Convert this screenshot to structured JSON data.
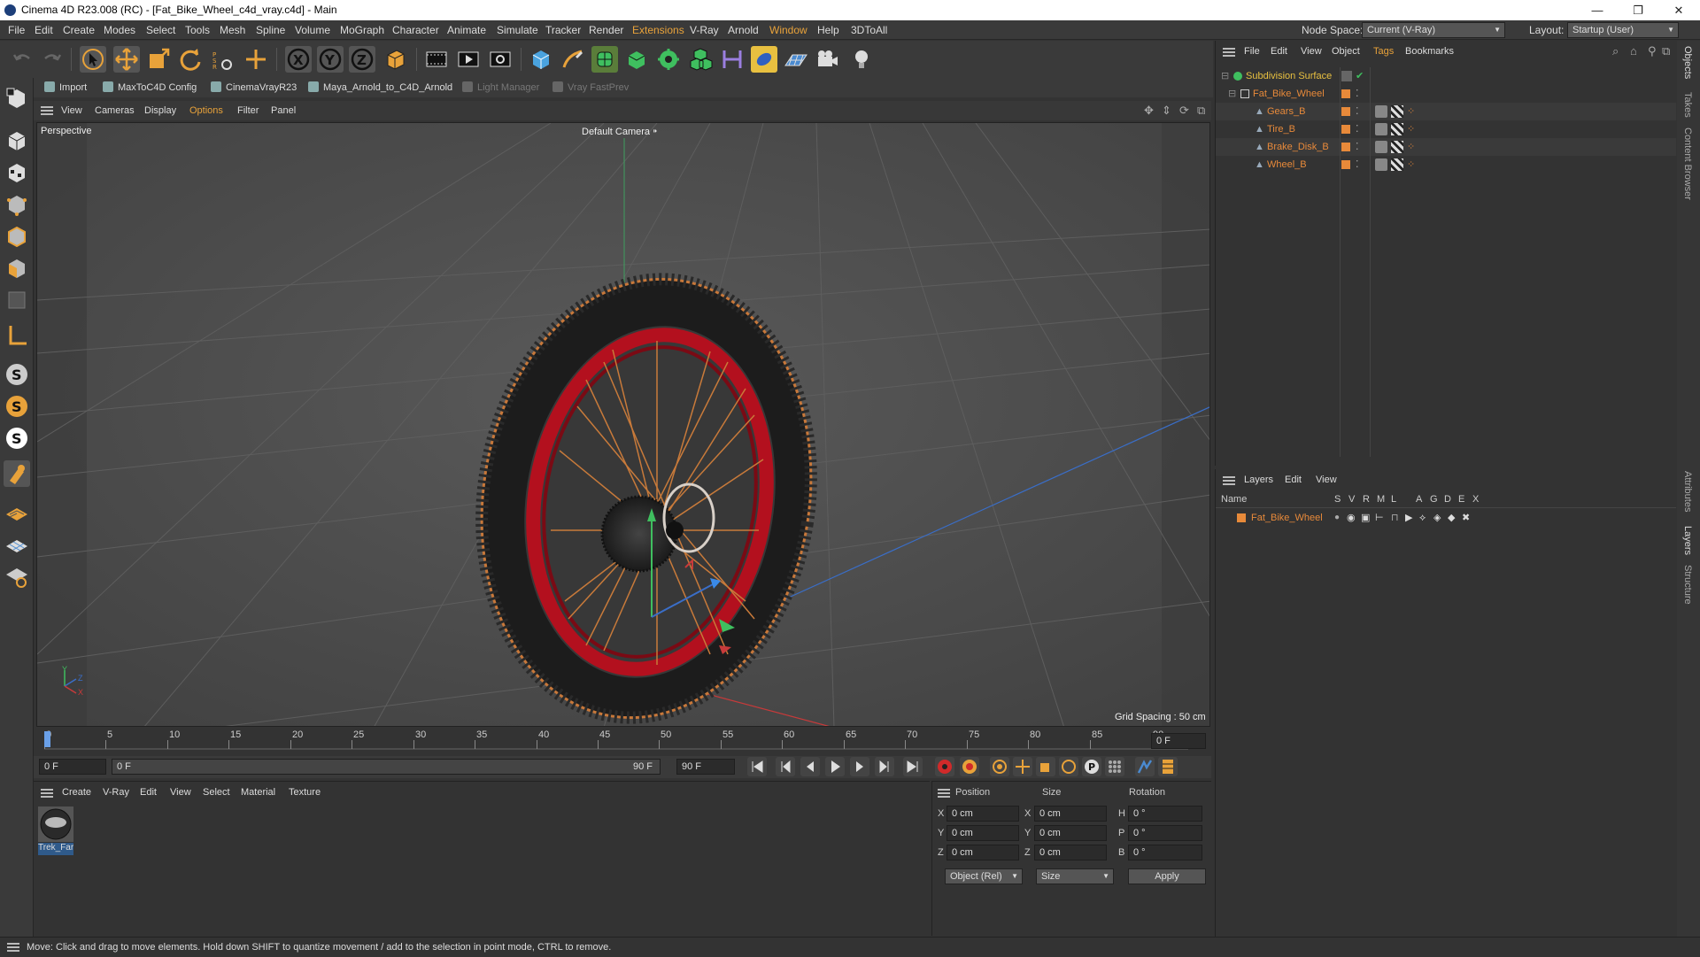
{
  "window": {
    "title": "Cinema 4D R23.008 (RC) - [Fat_Bike_Wheel_c4d_vray.c4d] - Main",
    "minimize": "—",
    "restore": "❐",
    "close": "✕"
  },
  "menubar": {
    "items": [
      "File",
      "Edit",
      "Create",
      "Modes",
      "Select",
      "Tools",
      "Mesh",
      "Spline",
      "Volume",
      "MoGraph",
      "Character",
      "Animate",
      "Simulate",
      "Tracker",
      "Render",
      "Extensions",
      "V-Ray",
      "Arnold",
      "Window",
      "Help",
      "3DToAll"
    ],
    "node_space_label": "Node Space:",
    "node_space_value": "Current (V-Ray)",
    "layout_label": "Layout:",
    "layout_value": "Startup (User)"
  },
  "plugins": {
    "import": "Import",
    "maxtoc4d": "MaxToC4D Config",
    "cinemavray": "CinemaVrayR23",
    "maya_arnold": "Maya_Arnold_to_C4D_Arnold",
    "light_manager": "Light Manager",
    "vray_fastprev": "Vray FastPrev"
  },
  "viewport": {
    "menu": [
      "View",
      "Cameras",
      "Display",
      "Options",
      "Filter",
      "Panel"
    ],
    "label": "Perspective",
    "camera": "Default Camera",
    "grid_spacing": "Grid Spacing : 50 cm",
    "axis_y": "Y",
    "axis_z": "Z",
    "axis_x": "X"
  },
  "timeline": {
    "ticks": [
      "0",
      "5",
      "10",
      "15",
      "20",
      "25",
      "30",
      "35",
      "40",
      "45",
      "50",
      "55",
      "60",
      "65",
      "70",
      "75",
      "80",
      "85",
      "90"
    ],
    "current_frame_field": "0 F",
    "start_field": "0 F",
    "range_start": "0 F",
    "range_end": "90 F",
    "end_field": "90 F"
  },
  "materials": {
    "menu": [
      "Create",
      "V-Ray",
      "Edit",
      "View",
      "Select",
      "Material",
      "Texture"
    ],
    "items": [
      {
        "name": "Trek_Far"
      }
    ]
  },
  "coords": {
    "headers": {
      "position": "Position",
      "size": "Size",
      "rotation": "Rotation"
    },
    "rows": [
      {
        "axis": "X",
        "pos": "0 cm",
        "saxis": "X",
        "size": "0 cm",
        "raxis": "H",
        "rot": "0 °"
      },
      {
        "axis": "Y",
        "pos": "0 cm",
        "saxis": "Y",
        "size": "0 cm",
        "raxis": "P",
        "rot": "0 °"
      },
      {
        "axis": "Z",
        "pos": "0 cm",
        "saxis": "Z",
        "size": "0 cm",
        "raxis": "B",
        "rot": "0 °"
      }
    ],
    "mode": "Object (Rel)",
    "size_mode": "Size",
    "apply": "Apply"
  },
  "objects": {
    "menu": [
      "File",
      "Edit",
      "View",
      "Object",
      "Tags",
      "Bookmarks"
    ],
    "tree": [
      {
        "name": "Subdivision Surface",
        "color": "#e8c040"
      },
      {
        "name": "Fat_Bike_Wheel",
        "color": "#e88a3a"
      },
      {
        "name": "Gears_B",
        "color": "#e88a3a"
      },
      {
        "name": "Tire_B",
        "color": "#e88a3a"
      },
      {
        "name": "Brake_Disk_B",
        "color": "#e88a3a"
      },
      {
        "name": "Wheel_B",
        "color": "#e88a3a"
      }
    ]
  },
  "layers": {
    "menu": [
      "Layers",
      "Edit",
      "View"
    ],
    "col_name": "Name",
    "cols": [
      "S",
      "V",
      "R",
      "M",
      "L",
      "A",
      "G",
      "D",
      "E",
      "X"
    ],
    "items": [
      {
        "name": "Fat_Bike_Wheel",
        "color": "#e88a3a"
      }
    ]
  },
  "right_tabs": [
    "Objects",
    "Takes",
    "Content Browser",
    "Attributes",
    "Layers",
    "Structure"
  ],
  "status": "Move: Click and drag to move elements. Hold down SHIFT to quantize movement / add to the selection in point mode, CTRL to remove.",
  "colors": {
    "accent_orange": "#e8a23a",
    "rim_red": "#b3101e",
    "spoke_copper": "#c87a3a",
    "object_orange": "#e88a3a"
  }
}
